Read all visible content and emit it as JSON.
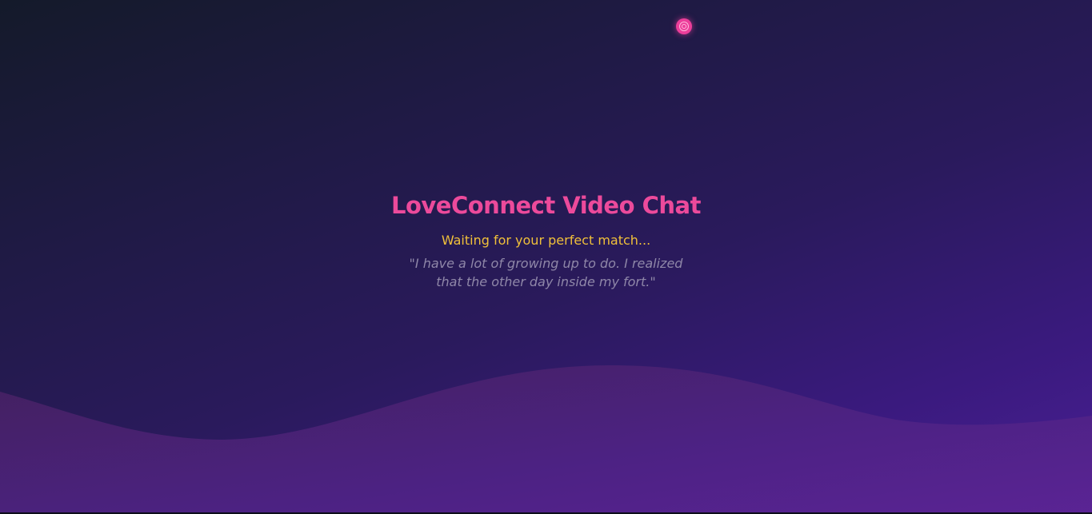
{
  "app": {
    "title": "LoveConnect Video Chat",
    "status": "Waiting for your perfect match...",
    "quote": "\"I have a lot of growing up to do. I realized that the other day inside my fort.\""
  },
  "indicator": {
    "icon": "target-icon",
    "color": "#ec3e9a"
  },
  "colors": {
    "title": "#ec4a9b",
    "status": "#f0c03a",
    "quote": "#8f87a8",
    "background_start": "#141a2a",
    "background_end": "#4a1f95",
    "wave": "#5a2590"
  }
}
